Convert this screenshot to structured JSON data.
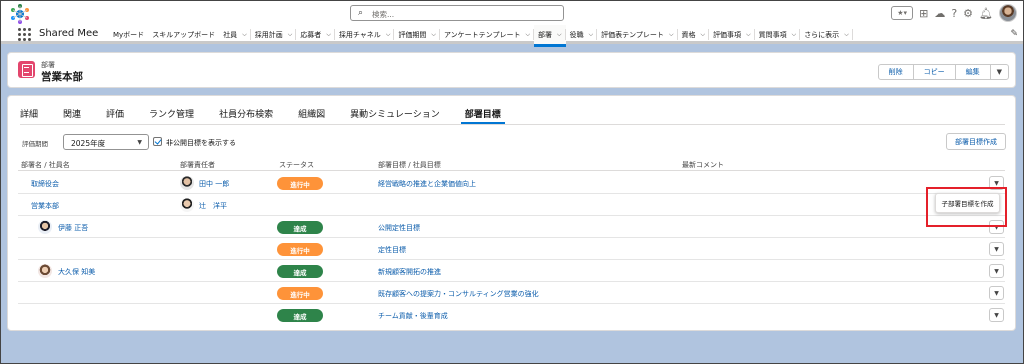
{
  "header": {
    "search_placeholder": "検索...",
    "app_name": "Shared Mee"
  },
  "nav": {
    "items": [
      {
        "label": "Myボード",
        "chev": false
      },
      {
        "label": "スキルアップボード",
        "chev": false
      },
      {
        "label": "社員",
        "chev": true
      },
      {
        "label": "採用計画",
        "chev": true
      },
      {
        "label": "応募者",
        "chev": true
      },
      {
        "label": "採用チャネル",
        "chev": true
      },
      {
        "label": "評価期間",
        "chev": true
      },
      {
        "label": "アンケートテンプレート",
        "chev": true
      },
      {
        "label": "部署",
        "chev": true,
        "active": true
      },
      {
        "label": "役職",
        "chev": true
      },
      {
        "label": "評価表テンプレート",
        "chev": true
      },
      {
        "label": "資格",
        "chev": true
      },
      {
        "label": "評価事項",
        "chev": true
      },
      {
        "label": "質問事項",
        "chev": true
      },
      {
        "label": "さらに表示",
        "chev": true
      }
    ]
  },
  "record": {
    "object_label": "部署",
    "title": "営業本部",
    "actions": [
      "削除",
      "コピー",
      "編集"
    ]
  },
  "tabs": [
    "詳細",
    "関連",
    "評価",
    "ランク管理",
    "社員分布検索",
    "組織図",
    "異動シミュレーション",
    "部署目標"
  ],
  "active_tab": 7,
  "filters": {
    "period_label": "評価期間",
    "period_value": "2025年度",
    "show_private_label": "非公開目標を表示する",
    "show_private_checked": true,
    "create_button": "部署目標作成"
  },
  "table": {
    "headers": [
      "部署名 / 社員名",
      "部署責任者",
      "ステータス",
      "部署目標 / 社員目標",
      "最新コメント"
    ],
    "rows": [
      {
        "dept": "取締役会",
        "manager": "田中 一郎",
        "status": "進行中",
        "status_type": "prog",
        "goal": "経営戦略の推進と企業価値向上"
      },
      {
        "dept": "営業本部",
        "manager": "辻　洋平",
        "status": "",
        "status_type": "",
        "goal": ""
      },
      {
        "employee": "伊藤 正吾",
        "status": "達成",
        "status_type": "done",
        "goal": "公開定性目標"
      },
      {
        "status": "進行中",
        "status_type": "prog",
        "goal": "定性目標"
      },
      {
        "employee": "大久保 知美",
        "status": "達成",
        "status_type": "done",
        "goal": "新規顧客開拓の推進"
      },
      {
        "status": "進行中",
        "status_type": "prog",
        "goal": "既存顧客への提案力・コンサルティング営業の強化"
      },
      {
        "status": "達成",
        "status_type": "done",
        "goal": "チーム貢献・後輩育成"
      }
    ]
  },
  "row_menu": {
    "item": "子部署目標を作成"
  },
  "colors": {
    "accent": "#0176d3",
    "status_in_progress": "#fe9339",
    "status_done": "#2e844a",
    "callout": "#e4202a",
    "object_icon": "#e3466d"
  }
}
